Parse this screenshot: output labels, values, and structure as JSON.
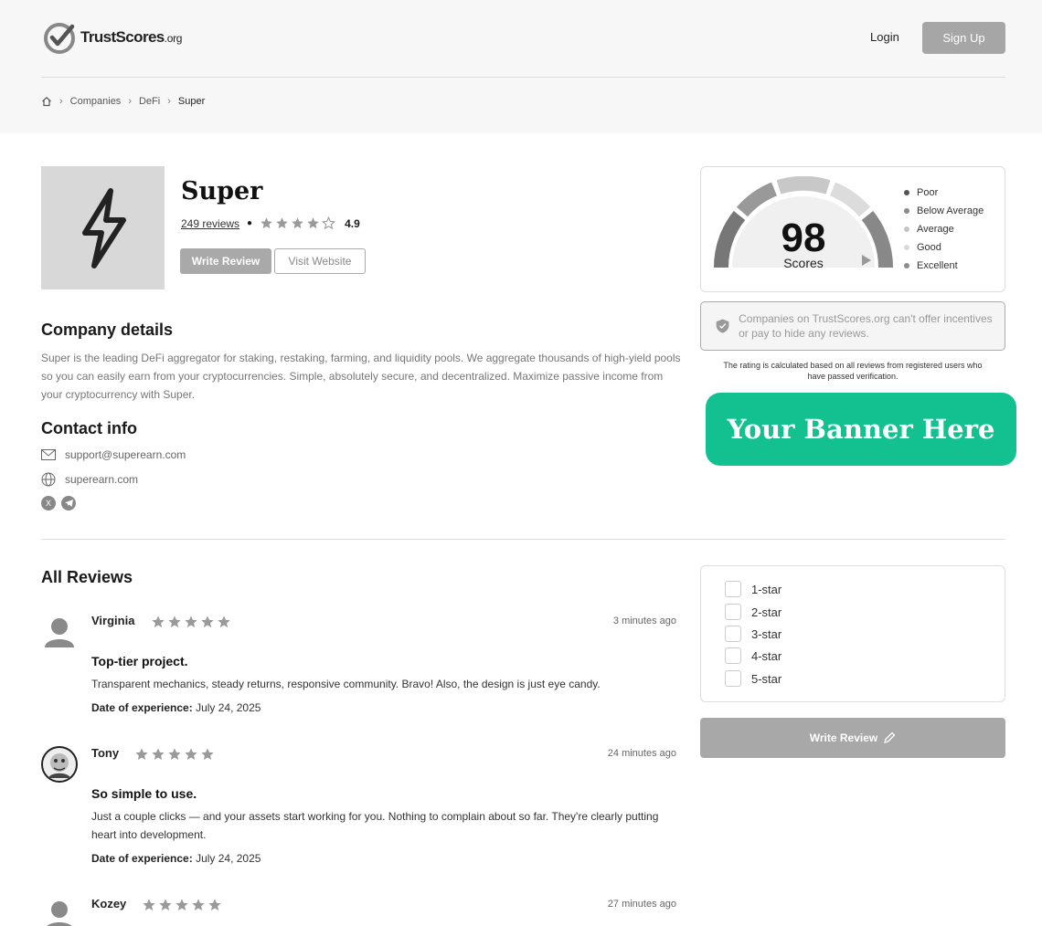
{
  "header": {
    "logo_main": "TrustScores",
    "logo_suffix": ".org",
    "login_label": "Login",
    "signup_label": "Sign Up"
  },
  "breadcrumb": {
    "items": [
      "Companies",
      "DeFi",
      "Super"
    ]
  },
  "company": {
    "name": "Super",
    "reviews_link": "249 reviews",
    "rating_value": "4.9",
    "stars_shown": 4,
    "write_review_label": "Write Review",
    "visit_website_label": "Visit Website"
  },
  "details": {
    "heading": "Company details",
    "description": "Super is the leading DeFi aggregator for staking, restaking, farming, and liquidity pools. We aggregate thousands of high-yield pools so you can easily earn from your cryptocurrencies. Simple, absolutely secure, and decentralized. Maximize passive income from your cryptocurrency with Super."
  },
  "contact": {
    "heading": "Contact info",
    "email": "support@superearn.com",
    "website": "superearn.com"
  },
  "score_card": {
    "score": "98",
    "label": "Scores",
    "legend": [
      "Poor",
      "Below Average",
      "Average",
      "Good",
      "Excellent"
    ],
    "legend_colors": [
      "#555555",
      "#8a8a8a",
      "#c4c4c4",
      "#d9d9d9",
      "#8c8c8c"
    ]
  },
  "notice": {
    "text": "Companies on TrustScores.org can't offer incentives or pay to hide any reviews.",
    "rating_note": "The rating is calculated based on all reviews from registered users who have passed verification."
  },
  "banner": {
    "text": "Your Banner Here",
    "color": "#12c18f"
  },
  "reviews": {
    "heading": "All Reviews",
    "date_label": "Date of experience:",
    "items": [
      {
        "name": "Virginia",
        "time": "3 minutes ago",
        "title": "Top-tier project.",
        "body": "Transparent mechanics, steady returns, responsive community. Bravo! Also, the design is just eye candy.",
        "date": "July 24, 2025",
        "stars": 5
      },
      {
        "name": "Tony",
        "time": "24 minutes ago",
        "title": "So simple to use.",
        "body": "Just a couple clicks — and your assets start working for you. Nothing to complain about so far. They're clearly putting heart into development.",
        "date": "July 24, 2025",
        "stars": 5
      },
      {
        "name": "Kozey",
        "time": "27 minutes ago",
        "stars": 5
      }
    ]
  },
  "filter": {
    "options": [
      "1-star",
      "2-star",
      "3-star",
      "4-star",
      "5-star"
    ]
  },
  "write_review_bottom": "Write Review"
}
